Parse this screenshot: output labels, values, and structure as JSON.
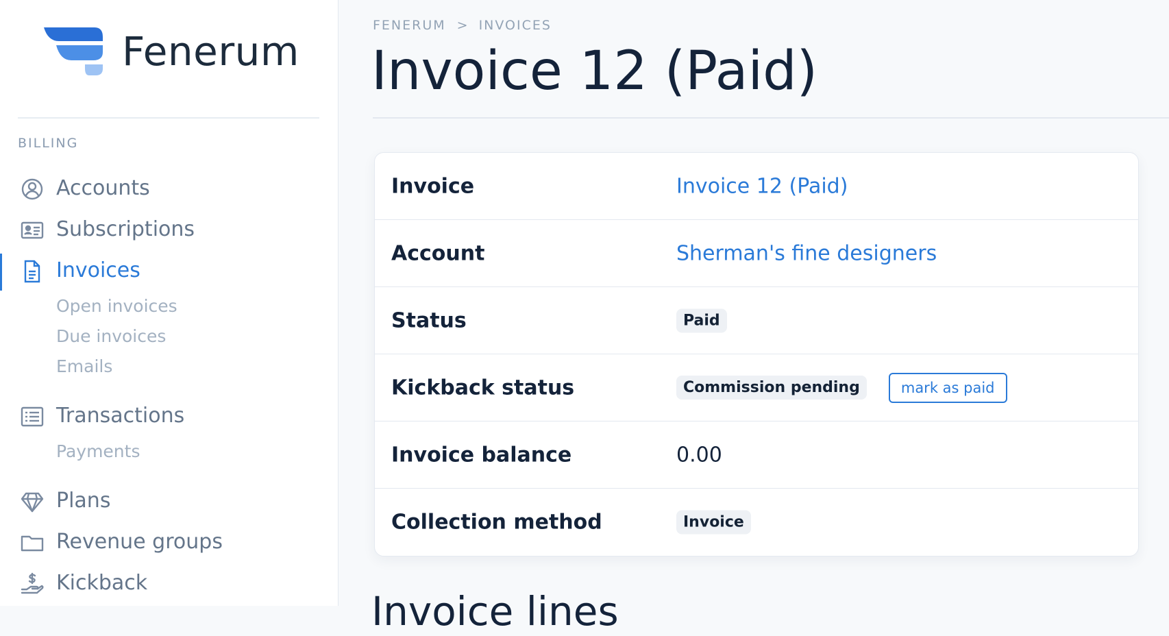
{
  "brand": {
    "name": "Fenerum",
    "logo_color_dark": "#2a6fd6",
    "logo_color_mid": "#4c8fe6",
    "logo_color_light": "#9ec3f4"
  },
  "sidebar": {
    "section_label": "BILLING",
    "items": [
      {
        "label": "Accounts",
        "icon": "user-circle-icon"
      },
      {
        "label": "Subscriptions",
        "icon": "id-card-icon"
      },
      {
        "label": "Invoices",
        "icon": "document-icon",
        "active": true,
        "children": [
          {
            "label": "Open invoices"
          },
          {
            "label": "Due invoices"
          },
          {
            "label": "Emails"
          }
        ]
      },
      {
        "label": "Transactions",
        "icon": "list-icon",
        "children": [
          {
            "label": "Payments"
          }
        ]
      },
      {
        "label": "Plans",
        "icon": "diamond-icon"
      },
      {
        "label": "Revenue groups",
        "icon": "folder-icon"
      },
      {
        "label": "Kickback",
        "icon": "hand-coin-icon"
      }
    ]
  },
  "breadcrumb": {
    "items": [
      "FENERUM",
      "INVOICES"
    ],
    "separator": ">"
  },
  "page": {
    "title": "Invoice 12 (Paid)",
    "next_section_title": "Invoice lines"
  },
  "details": {
    "rows": [
      {
        "key": "Invoice",
        "value": "Invoice 12 (Paid)"
      },
      {
        "key": "Account",
        "value": "Sherman's fine designers"
      },
      {
        "key": "Status",
        "value": "Paid"
      },
      {
        "key": "Kickback status",
        "value": "Commission pending",
        "action": "mark as paid"
      },
      {
        "key": "Invoice balance",
        "value": "0.00"
      },
      {
        "key": "Collection method",
        "value": "Invoice"
      }
    ]
  },
  "colors": {
    "accent": "#2a7ad8",
    "text": "#14233a",
    "muted": "#64758a",
    "subtle": "#a3b1c1"
  }
}
